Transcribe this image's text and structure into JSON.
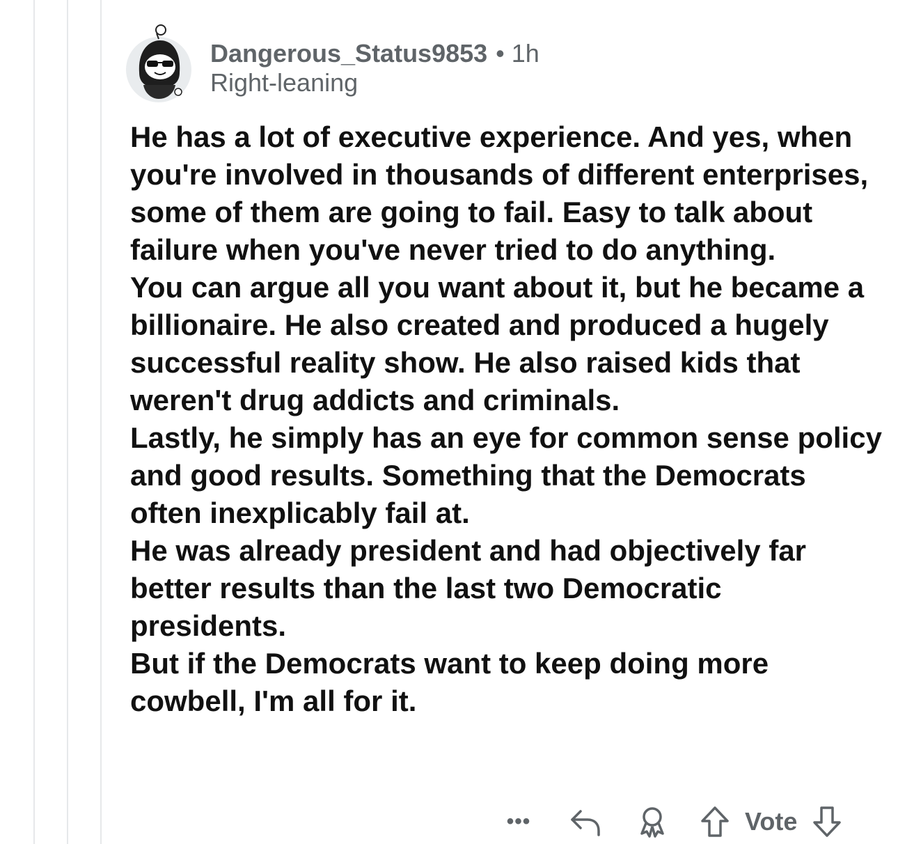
{
  "comment": {
    "username": "Dangerous_Status9853",
    "separator": "•",
    "age": "1h",
    "flair": "Right-leaning",
    "paragraphs": [
      "He has a lot of executive experience. And yes, when you're involved in thousands of different enterprises, some of them are going to fail.  Easy to talk about failure when you've never tried to do anything.",
      "You can argue all you want about it, but he became a billionaire. He also created and produced a hugely successful reality show.   He also raised kids that weren't drug addicts and criminals.",
      "Lastly, he simply has an eye for common sense policy and good results. Something that the Democrats often inexplicably fail at.",
      "He was already president and had objectively far better results than the last two Democratic presidents.",
      "But if the Democrats want to keep doing more cowbell, I'm all for it."
    ]
  },
  "actions": {
    "more": "•••",
    "vote_label": "Vote"
  },
  "icons": {
    "avatar": "avatar-icon",
    "more": "more-options-icon",
    "reply": "reply-icon",
    "award": "award-icon",
    "upvote": "upvote-arrow-icon",
    "downvote": "downvote-arrow-icon"
  },
  "colors": {
    "meta_text": "#5f6468",
    "body_text": "#111111",
    "thread_line": "#e6e8ea"
  }
}
